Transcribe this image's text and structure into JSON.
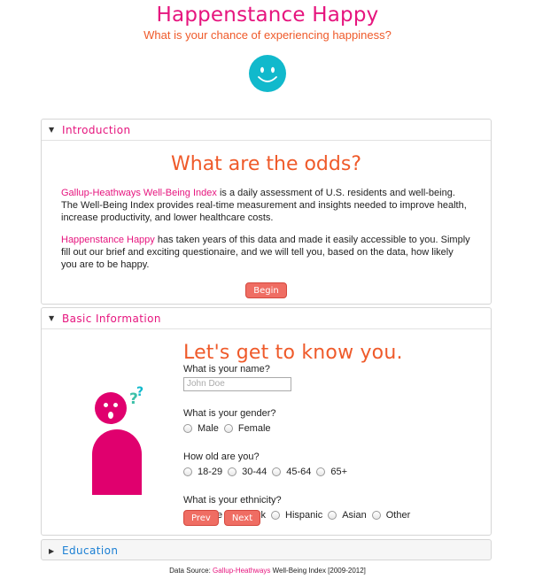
{
  "header": {
    "title": "Happenstance Happy",
    "subtitle": "What is your chance of experiencing happiness?",
    "logo_icon": "smiley-face-icon"
  },
  "colors": {
    "brand_pink": "#e6157e",
    "accent_orange": "#ef5a2a",
    "logo_teal": "#11b9cc",
    "button": "#ef6d63",
    "link_blue": "#1a7fd4"
  },
  "intro": {
    "section_label": "Introduction",
    "heading": "What are the odds?",
    "p1_link": "Gallup-Heathways Well-Being Index",
    "p1_text": " is a daily assessment of U.S. residents and well-being. The Well-Being Index provides real-time measurement and insights needed to improve health, increase productivity, and lower healthcare costs.",
    "p2_link": "Happenstance Happy",
    "p2_text": " has taken years of this data and made it easily accessible to you. Simply fill out our brief and exciting questionaire, and we will tell you, based on the data, how likely you are to be happy.",
    "begin_label": "Begin"
  },
  "basic": {
    "section_label": "Basic Information",
    "heading": "Let's get to know you.",
    "name_q": "What is your name?",
    "name_placeholder": "John Doe",
    "gender_q": "What is your gender?",
    "gender_opts": [
      "Male",
      "Female"
    ],
    "age_q": "How old are you?",
    "age_opts": [
      "18-29",
      "30-44",
      "45-64",
      "65+"
    ],
    "eth_q": "What is your ethnicity?",
    "eth_opts": [
      "White",
      "Black",
      "Hispanic",
      "Asian",
      "Other"
    ],
    "prev_label": "Prev",
    "next_label": "Next"
  },
  "education": {
    "section_label": "Education"
  },
  "footer": {
    "prefix": "Data Source: ",
    "link": "Gallup-Heathways",
    "suffix": " Well-Being Index [2009-2012]"
  }
}
